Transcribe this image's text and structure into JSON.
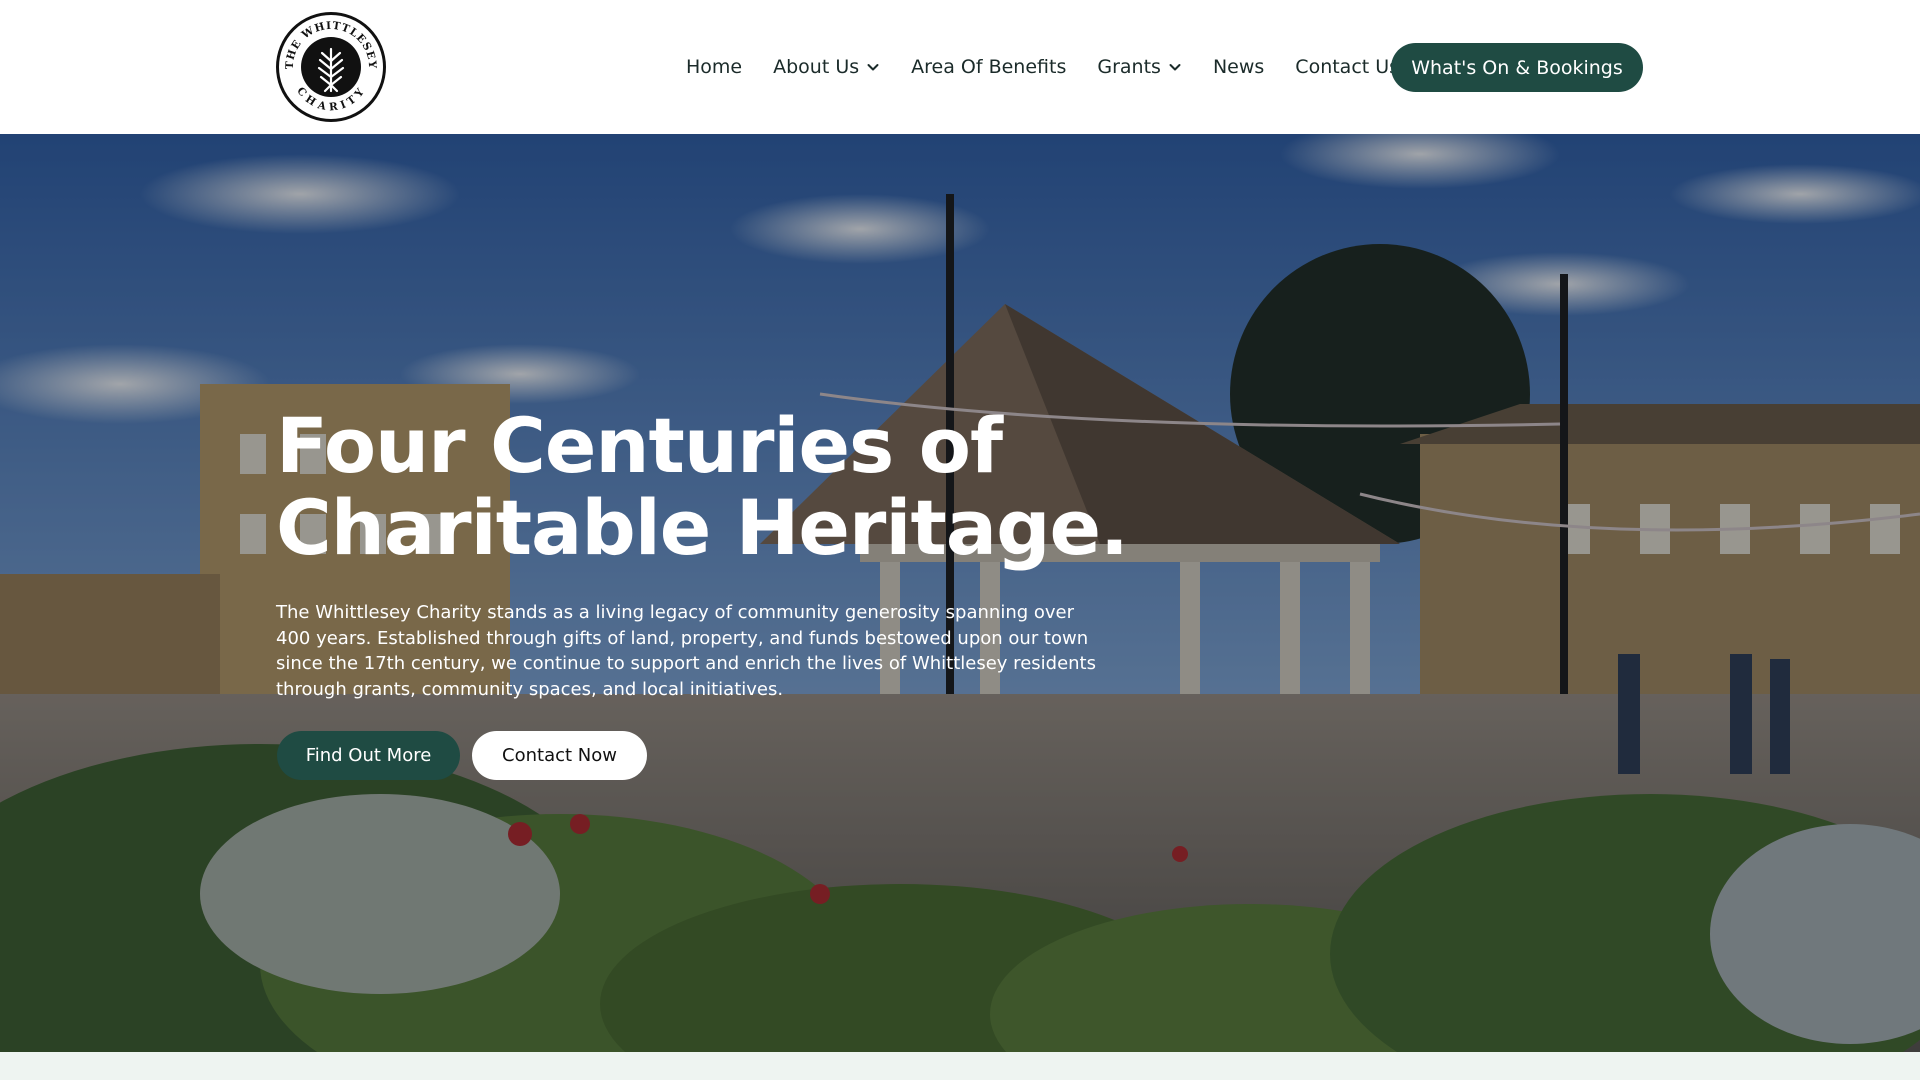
{
  "site": {
    "logo_text": "THE WHITTLESEY CHARITY",
    "logo_top": "THE WHITTLESEY",
    "logo_bottom": "CHARITY"
  },
  "nav": {
    "items": [
      {
        "label": "Home",
        "has_dropdown": false
      },
      {
        "label": "About Us",
        "has_dropdown": true
      },
      {
        "label": "Area Of Benefits",
        "has_dropdown": false
      },
      {
        "label": "Grants",
        "has_dropdown": true
      },
      {
        "label": "News",
        "has_dropdown": false
      },
      {
        "label": "Contact Us",
        "has_dropdown": false
      }
    ],
    "cta_label": "What's On & Bookings"
  },
  "hero": {
    "title_line1": "Four Centuries of",
    "title_line2": "Charitable Heritage.",
    "body": "The Whittlesey Charity stands as a living legacy of community generosity spanning over 400 years. Established through gifts of land, property, and funds bestowed upon our town since the 17th century, we continue to support and enrich the lives of Whittlesey residents through grants, community spaces, and local initiatives.",
    "primary_button": "Find Out More",
    "secondary_button": "Contact Now"
  },
  "colors": {
    "brand_green": "#1f4b43",
    "nav_text": "#1b2b2a",
    "band": "#eef4f1"
  },
  "icons": {
    "dropdown": "chevron-down-icon"
  }
}
